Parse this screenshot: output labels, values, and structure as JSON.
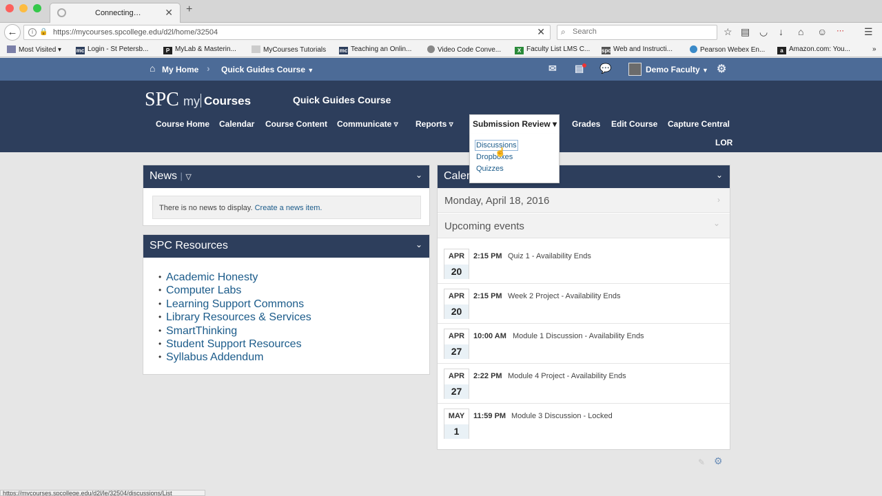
{
  "browser": {
    "tab_title": "Connecting…",
    "url": "https://mycourses.spcollege.edu/d2l/home/32504",
    "search_placeholder": "Search",
    "status_url": "https://mycourses.spcollege.edu/d2l/le/32504/discussions/List"
  },
  "bookmarks": [
    {
      "label": "Most Visited ▾",
      "color": "#7a7fa8"
    },
    {
      "label": "Login - St Petersb...",
      "color": "#2d3e5c"
    },
    {
      "label": "MyLab & Masterin...",
      "color": "#222222"
    },
    {
      "label": "MyCourses Tutorials",
      "color": "#cccccc"
    },
    {
      "label": "Teaching an Onlin...",
      "color": "#2d3e5c"
    },
    {
      "label": "Video Code Conve...",
      "color": "#888888"
    },
    {
      "label": "Faculty List LMS C...",
      "color": "#2a8a3a"
    },
    {
      "label": "Web and Instructi...",
      "color": "#555555"
    },
    {
      "label": "Pearson Webex En...",
      "color": "#3a8ac8"
    },
    {
      "label": "Amazon.com: You...",
      "color": "#222222"
    }
  ],
  "minibar": {
    "home": "My Home",
    "course": "Quick Guides Course",
    "user": "Demo Faculty"
  },
  "header": {
    "logo_spc": "SPC",
    "logo_my": "my",
    "logo_courses": "Courses",
    "course_title": "Quick Guides Course",
    "nav": [
      "Course Home",
      "Calendar",
      "Course Content",
      "Communicate ▿",
      "Reports ▿",
      "Grades",
      "Edit Course",
      "Capture Central",
      "LOR"
    ],
    "open_menu": "Submission Review ▾",
    "menu_items": [
      "Discussions",
      "Dropboxes",
      "Quizzes"
    ]
  },
  "news": {
    "title": "News",
    "message": "There is no news to display.",
    "link": "Create a news item."
  },
  "resources": {
    "title": "SPC Resources",
    "items": [
      "Academic Honesty",
      "Computer Labs",
      "Learning Support Commons",
      "Library Resources & Services",
      "SmartThinking",
      "Student Support Resources",
      "Syllabus Addendum"
    ]
  },
  "calendar": {
    "title": "Calendar",
    "date": "Monday, April 18, 2016",
    "upcoming": "Upcoming events",
    "events": [
      {
        "month": "APR",
        "day": "20",
        "time": "2:15 PM",
        "title": "Quiz 1 - Availability Ends"
      },
      {
        "month": "APR",
        "day": "20",
        "time": "2:15 PM",
        "title": "Week 2 Project - Availability Ends"
      },
      {
        "month": "APR",
        "day": "27",
        "time": "10:00 AM",
        "title": "Module 1 Discussion - Availability Ends"
      },
      {
        "month": "APR",
        "day": "27",
        "time": "2:22 PM",
        "title": "Module 4 Project - Availability Ends"
      },
      {
        "month": "MAY",
        "day": "1",
        "time": "11:59 PM",
        "title": "Module 3 Discussion - Locked"
      }
    ]
  },
  "colors": {
    "header_navy": "#2d3e5c",
    "minibar_blue": "#4c6b97",
    "link_blue": "#1b5b8a"
  }
}
